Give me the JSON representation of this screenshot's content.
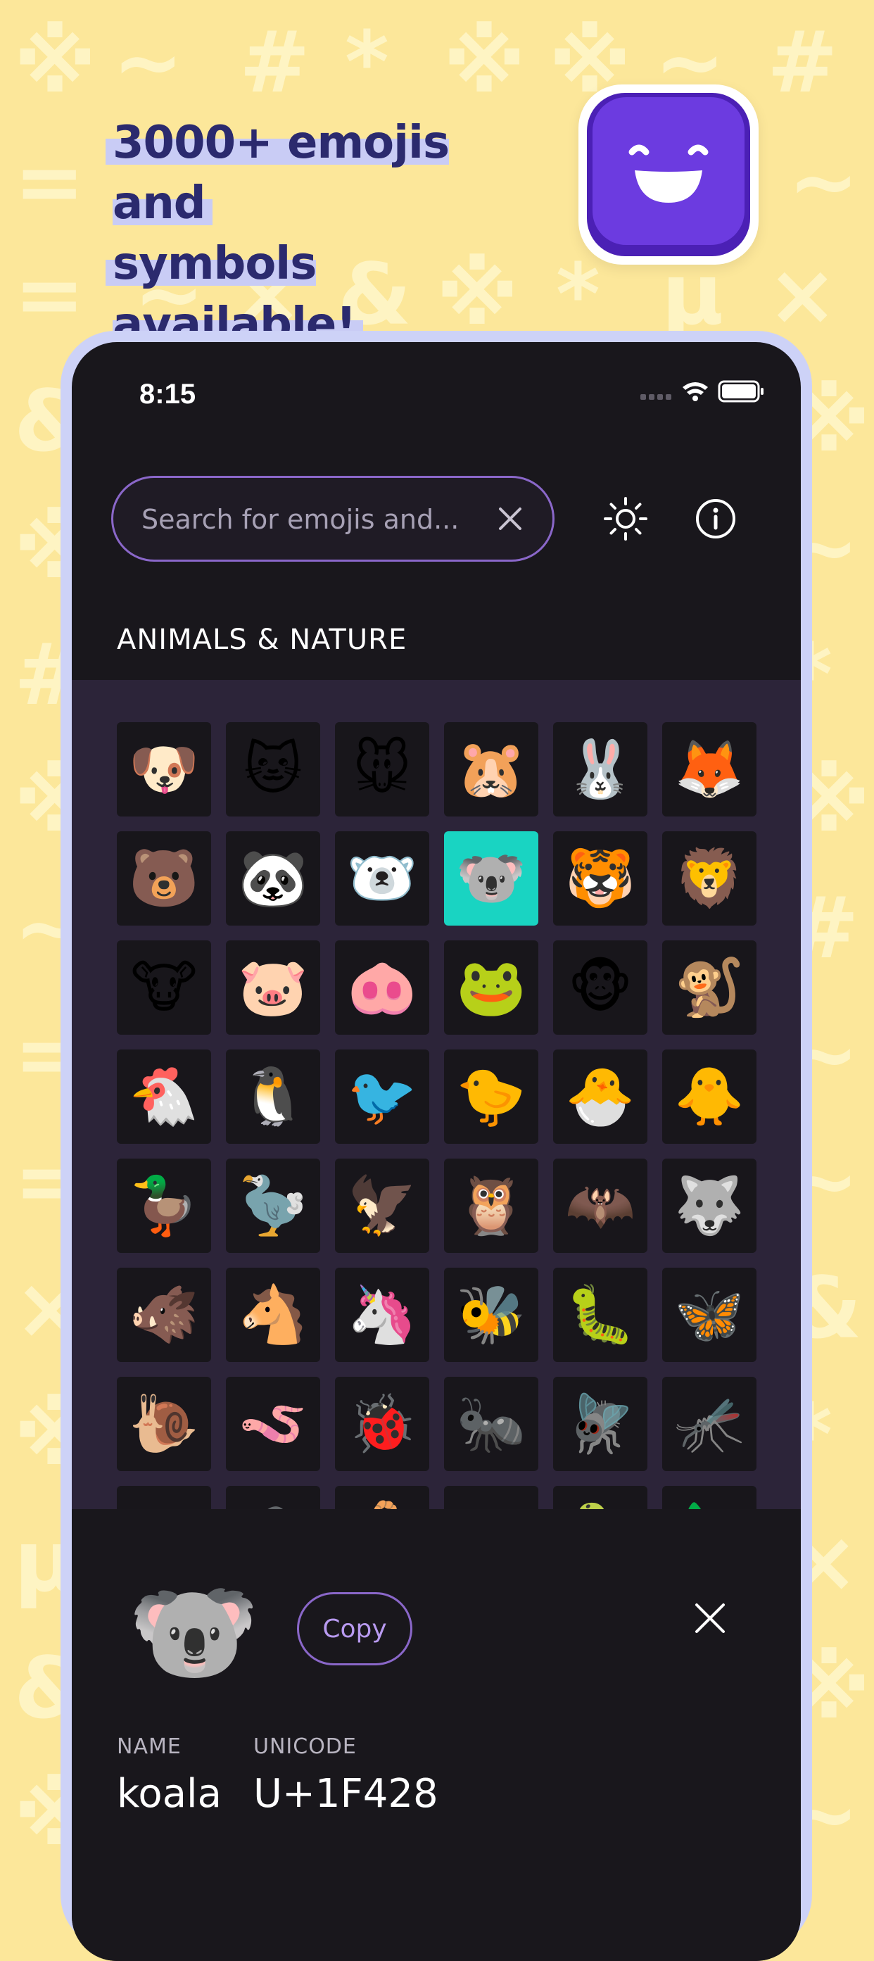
{
  "headline": {
    "line1": "3000+ emojis and",
    "line2": "symbols available!"
  },
  "app_icon": {
    "name": "smiley-app-icon",
    "color": "#6c3be0"
  },
  "background": {
    "color": "#fce79a",
    "glyph_color": "#fff6c8"
  },
  "status_bar": {
    "time": "8:15"
  },
  "search": {
    "placeholder": "Search for emojis and..."
  },
  "toolbar": {
    "theme_icon": "sun-icon",
    "info_icon": "info-icon"
  },
  "category": {
    "title": "ANIMALS & NATURE"
  },
  "emojis": [
    "🐶",
    "🐱",
    "🐭",
    "🐹",
    "🐰",
    "🦊",
    "🐻",
    "🐼",
    "🐻‍❄️",
    "🐨",
    "🐯",
    "🦁",
    "🐮",
    "🐷",
    "🐽",
    "🐸",
    "🐵",
    "🐒",
    "🐔",
    "🐧",
    "🐦",
    "🐤",
    "🐣",
    "🐥",
    "🦆",
    "🦤",
    "🦅",
    "🦉",
    "🦇",
    "🐺",
    "🐗",
    "🐴",
    "🦄",
    "🐝",
    "🐛",
    "🦋",
    "🐌",
    "🪱",
    "🐞",
    "🐜",
    "🪰",
    "🦟",
    "🦗",
    "🕷️",
    "🦂",
    "🐢",
    "🐍",
    "🦎"
  ],
  "selected_index": 9,
  "detail": {
    "emoji": "🐨",
    "copy_label": "Copy",
    "name_label": "NAME",
    "name_value": "koala",
    "unicode_label": "UNICODE",
    "unicode_value": "U+1F428"
  },
  "colors": {
    "accent": "#8a67c9",
    "selected_cell": "#19d4c2",
    "headline": "#2b2a6e",
    "highlight": "#c9ccf5"
  }
}
